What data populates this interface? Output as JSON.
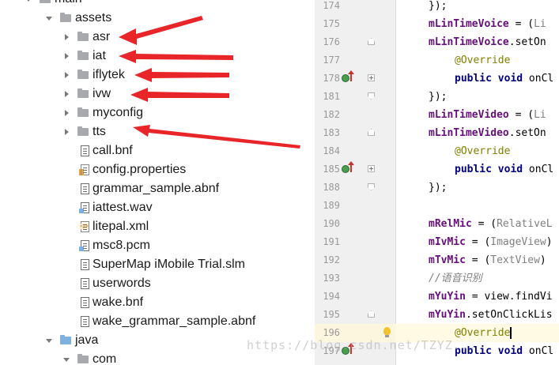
{
  "tree": {
    "items": [
      {
        "label": "main",
        "type": "folder",
        "state": "open",
        "indent": 0,
        "color": "grey"
      },
      {
        "label": "assets",
        "type": "folder",
        "state": "open",
        "indent": 1,
        "color": "grey"
      },
      {
        "label": "asr",
        "type": "folder",
        "state": "closed",
        "indent": 2,
        "color": "grey"
      },
      {
        "label": "iat",
        "type": "folder",
        "state": "closed",
        "indent": 2,
        "color": "grey"
      },
      {
        "label": "iflytek",
        "type": "folder",
        "state": "closed",
        "indent": 2,
        "color": "grey"
      },
      {
        "label": "ivw",
        "type": "folder",
        "state": "closed",
        "indent": 2,
        "color": "grey"
      },
      {
        "label": "myconfig",
        "type": "folder",
        "state": "closed",
        "indent": 2,
        "color": "grey"
      },
      {
        "label": "tts",
        "type": "folder",
        "state": "closed",
        "indent": 2,
        "color": "grey"
      },
      {
        "label": "call.bnf",
        "type": "file",
        "icon": "text",
        "indent": 2
      },
      {
        "label": "config.properties",
        "type": "file",
        "icon": "properties",
        "indent": 2
      },
      {
        "label": "grammar_sample.abnf",
        "type": "file",
        "icon": "text",
        "indent": 2
      },
      {
        "label": "iattest.wav",
        "type": "file",
        "icon": "audio",
        "indent": 2
      },
      {
        "label": "litepal.xml",
        "type": "file",
        "icon": "xml",
        "indent": 2
      },
      {
        "label": "msc8.pcm",
        "type": "file",
        "icon": "audio",
        "indent": 2
      },
      {
        "label": "SuperMap iMobile Trial.slm",
        "type": "file",
        "icon": "text",
        "indent": 2
      },
      {
        "label": "userwords",
        "type": "file",
        "icon": "text",
        "indent": 2
      },
      {
        "label": "wake.bnf",
        "type": "file",
        "icon": "text",
        "indent": 2
      },
      {
        "label": "wake_grammar_sample.abnf",
        "type": "file",
        "icon": "text",
        "indent": 2
      },
      {
        "label": "java",
        "type": "folder",
        "state": "open",
        "indent": 1,
        "color": "blue"
      },
      {
        "label": "com",
        "type": "folder",
        "state": "open",
        "indent": 2,
        "color": "grey"
      }
    ]
  },
  "editor": {
    "lines": [
      {
        "no": "174",
        "html": "});",
        "indent": 0
      },
      {
        "no": "175",
        "indent": 0,
        "parts": [
          [
            "field",
            "mLinTimeVoice"
          ],
          [
            "plain",
            " = ("
          ],
          [
            "cast",
            "Li"
          ]
        ]
      },
      {
        "no": "176",
        "indent": 0,
        "parts": [
          [
            "field",
            "mLinTimeVoice"
          ],
          [
            "plain",
            ".setOn"
          ]
        ],
        "fold": "start"
      },
      {
        "no": "177",
        "indent": 1,
        "parts": [
          [
            "ann",
            "@Override"
          ]
        ]
      },
      {
        "no": "178",
        "indent": 1,
        "parts": [
          [
            "kw",
            "public void "
          ],
          [
            "plain",
            "onCl"
          ]
        ],
        "override": true,
        "fold": "plus"
      },
      {
        "no": "181",
        "indent": 0,
        "parts": [
          [
            "plain",
            "});"
          ]
        ],
        "fold": "end"
      },
      {
        "no": "182",
        "indent": 0,
        "parts": [
          [
            "field",
            "mLinTimeVideo"
          ],
          [
            "plain",
            " = ("
          ],
          [
            "cast",
            "Li"
          ]
        ]
      },
      {
        "no": "183",
        "indent": 0,
        "parts": [
          [
            "field",
            "mLinTimeVideo"
          ],
          [
            "plain",
            ".setOn"
          ]
        ],
        "fold": "start"
      },
      {
        "no": "184",
        "indent": 1,
        "parts": [
          [
            "ann",
            "@Override"
          ]
        ]
      },
      {
        "no": "185",
        "indent": 1,
        "parts": [
          [
            "kw",
            "public void "
          ],
          [
            "plain",
            "onCl"
          ]
        ],
        "override": true,
        "fold": "plus"
      },
      {
        "no": "188",
        "indent": 0,
        "parts": [
          [
            "plain",
            "});"
          ]
        ],
        "fold": "end"
      },
      {
        "no": "189",
        "indent": 0,
        "parts": []
      },
      {
        "no": "190",
        "indent": 0,
        "parts": [
          [
            "field",
            "mRelMic"
          ],
          [
            "plain",
            " = ("
          ],
          [
            "cast",
            "RelativeL"
          ]
        ]
      },
      {
        "no": "191",
        "indent": 0,
        "parts": [
          [
            "field",
            "mIvMic"
          ],
          [
            "plain",
            " = ("
          ],
          [
            "cast",
            "ImageView"
          ],
          [
            "plain",
            ")"
          ]
        ]
      },
      {
        "no": "192",
        "indent": 0,
        "parts": [
          [
            "field",
            "mTvMic"
          ],
          [
            "plain",
            " = ("
          ],
          [
            "cast",
            "TextView"
          ],
          [
            "plain",
            ")"
          ]
        ]
      },
      {
        "no": "193",
        "indent": 0,
        "parts": [
          [
            "cm",
            "//语音识别"
          ]
        ]
      },
      {
        "no": "194",
        "indent": 0,
        "parts": [
          [
            "field",
            "mYuYin"
          ],
          [
            "plain",
            " = view.findVi"
          ]
        ]
      },
      {
        "no": "195",
        "indent": 0,
        "parts": [
          [
            "field",
            "mYuYin"
          ],
          [
            "plain",
            ".setOnClickLis"
          ]
        ],
        "fold": "start"
      },
      {
        "no": "196",
        "indent": 1,
        "parts": [
          [
            "ann",
            "@Override"
          ]
        ],
        "current": true,
        "bulb": true
      },
      {
        "no": "197",
        "indent": 1,
        "parts": [
          [
            "kw",
            "public void "
          ],
          [
            "plain",
            "onCl"
          ]
        ],
        "override": true
      }
    ]
  },
  "watermark": "https://blog.csdn.net/TZYZ...",
  "colors": {
    "annotation_arrow": "#e8262a",
    "current_line": "#fffae3",
    "field": "#660e7a",
    "keyword": "#000080"
  },
  "icons": {
    "folder": "folder-icon",
    "file": "file-icon",
    "override": "override-method-icon",
    "bulb": "intention-bulb-icon"
  }
}
